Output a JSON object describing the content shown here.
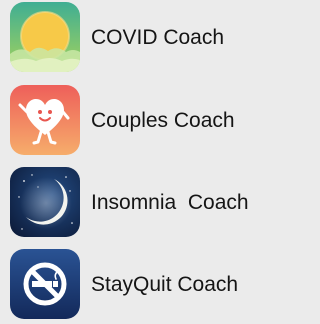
{
  "apps": [
    {
      "name": "COVID Coach",
      "icon": "covid-coach-icon",
      "colors": {
        "top": "#48b89a",
        "bottom": "#9fd15a",
        "sun": "#f6c74a"
      }
    },
    {
      "name": "Couples Coach",
      "icon": "couples-coach-icon",
      "colors": {
        "top": "#f06e5e",
        "bottom": "#f5a76a",
        "heart": "#ffffff"
      }
    },
    {
      "name": "Insomnia  Coach",
      "icon": "insomnia-coach-icon",
      "colors": {
        "top": "#1c3f73",
        "bottom": "#0d1d3b",
        "moon": "#f2f3ef"
      }
    },
    {
      "name": "StayQuit Coach",
      "icon": "stayquit-coach-icon",
      "colors": {
        "top": "#244a85",
        "bottom": "#142c57",
        "symbol": "#ffffff"
      }
    }
  ]
}
